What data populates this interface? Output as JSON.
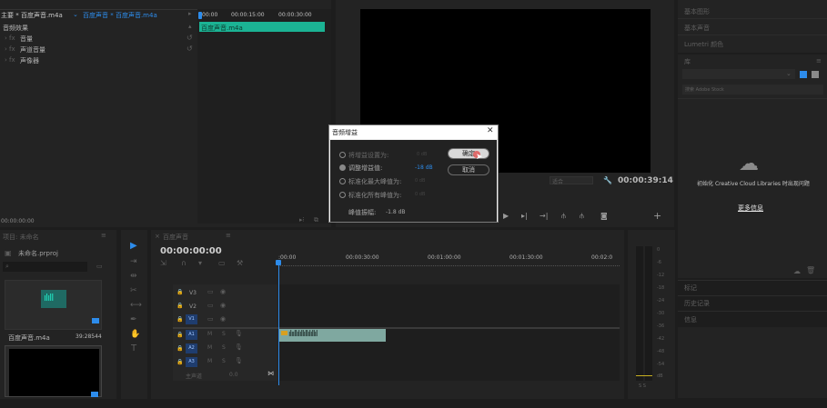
{
  "effect_controls": {
    "master_tab": "主要 * 百度声音.m4a",
    "clip_tab": "百度声音 * 百度声音.m4a",
    "section": "音频效果",
    "effects": [
      "音量",
      "声道音量",
      "声像器"
    ],
    "timecode": "00:00:00:00",
    "ruler": [
      "00:00",
      "00:00:15:00",
      "00:00:30:00"
    ],
    "clip_name": "百度声音.m4a"
  },
  "program_monitor": {
    "timecode": "00:00:39:14",
    "fit": "适合"
  },
  "right_panels": {
    "top_items": [
      "基本图形",
      "基本声音",
      "Lumetri 颜色"
    ],
    "libraries_tab": "库",
    "adobe_stock": "搜索 Adobe Stock",
    "cc_message": "初始化 Creative Cloud Libraries 时出现问题",
    "more_info": "更多信息",
    "bottom_items": [
      "标记",
      "历史记录",
      "信息"
    ]
  },
  "project_panel": {
    "title": "项目: 未命名",
    "project_file": "未命名.prproj",
    "item_name": "百度声音.m4a",
    "item_duration": "39:28544"
  },
  "timeline": {
    "tab": "百度声音",
    "timecode": "00:00:00:00",
    "ruler": [
      ":00:00",
      "00:00:30:00",
      "00:01:00:00",
      "00:01:30:00",
      "00:02:0"
    ],
    "video_tracks": [
      "V3",
      "V2",
      "V1"
    ],
    "audio_tracks": [
      "A1",
      "A2",
      "A3"
    ],
    "master_track": "主声道",
    "master_value": "0.0"
  },
  "audio_meter": {
    "scale": [
      "0",
      "-6",
      "-12",
      "-18",
      "-24",
      "-30",
      "-36",
      "-42",
      "-48",
      "-54",
      "dB"
    ],
    "solo": "S S"
  },
  "dialog": {
    "title": "音频增益",
    "options": [
      {
        "label": "将增益设置为:",
        "value": "0 dB",
        "selected": false,
        "active": false
      },
      {
        "label": "调整增益值:",
        "value": "-18 dB",
        "selected": true,
        "active": true
      },
      {
        "label": "标准化最大峰值为:",
        "value": "0 dB",
        "selected": false,
        "active": false
      },
      {
        "label": "标准化所有峰值为:",
        "value": "0 dB",
        "selected": false,
        "active": false
      }
    ],
    "ok_label": "确定",
    "cancel_label": "取消",
    "peak_label": "峰值振幅:",
    "peak_value": "-1.8 dB"
  },
  "colors": {
    "accent": "#2d8ceb",
    "clip": "#1bb394",
    "audio_clip": "#7fa8a0",
    "track_selected": "#1f3d6e"
  }
}
